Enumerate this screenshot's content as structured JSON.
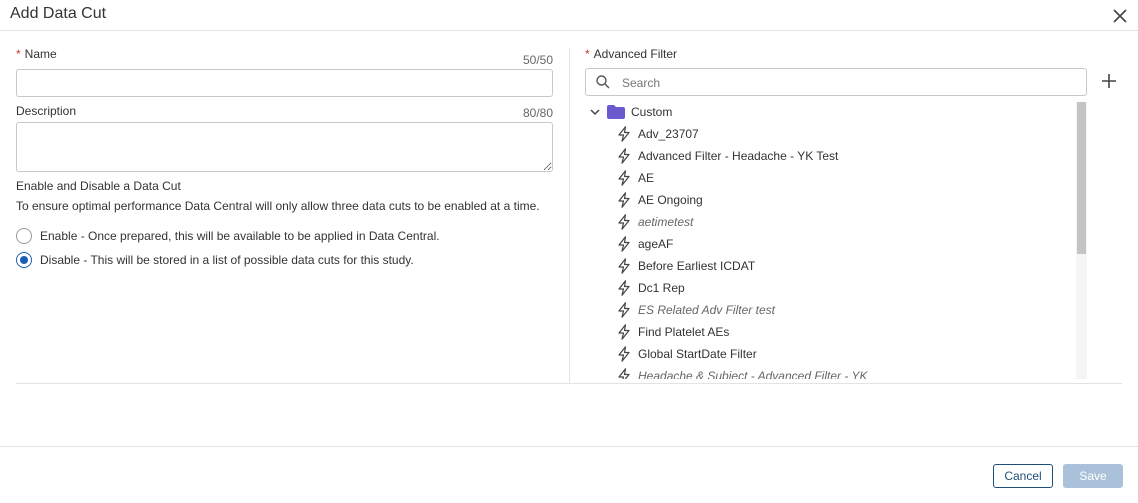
{
  "dialog": {
    "title": "Add Data Cut"
  },
  "form": {
    "name": {
      "required_mark": "*",
      "label": "Name",
      "counter": "50/50",
      "value": ""
    },
    "description": {
      "label": "Description",
      "counter": "80/80",
      "value": ""
    },
    "enable_section": {
      "title": "Enable and Disable a Data Cut",
      "description": "To ensure optimal performance Data Central will only allow three data cuts to be enabled at a time.",
      "options": [
        {
          "label": "Enable - Once prepared, this will be available to be applied in Data Central.",
          "selected": false
        },
        {
          "label": "Disable - This will be stored in a list of possible data cuts for this study.",
          "selected": true
        }
      ]
    }
  },
  "advanced_filter": {
    "required_mark": "*",
    "label": "Advanced Filter",
    "search_placeholder": "Search",
    "tree": {
      "folder_label": "Custom",
      "folder_icon_color": "#6a5acd",
      "items": [
        {
          "label": "Adv_23707",
          "italic": false
        },
        {
          "label": "Advanced Filter - Headache - YK Test",
          "italic": false
        },
        {
          "label": "AE",
          "italic": false
        },
        {
          "label": "AE Ongoing",
          "italic": false
        },
        {
          "label": "aetimetest",
          "italic": true
        },
        {
          "label": "ageAF",
          "italic": false
        },
        {
          "label": "Before Earliest ICDAT",
          "italic": false
        },
        {
          "label": "Dc1 Rep",
          "italic": false
        },
        {
          "label": "ES Related Adv Filter test",
          "italic": true
        },
        {
          "label": "Find Platelet AEs",
          "italic": false
        },
        {
          "label": "Global StartDate Filter",
          "italic": false
        },
        {
          "label": "Headache & Subject - Advanced Filter - YK",
          "italic": true
        }
      ]
    }
  },
  "footer": {
    "cancel_label": "Cancel",
    "save_label": "Save"
  },
  "colors": {
    "accent": "#1a5fb4",
    "required": "#c0392b",
    "save_disabled": "#a9c2d9"
  }
}
